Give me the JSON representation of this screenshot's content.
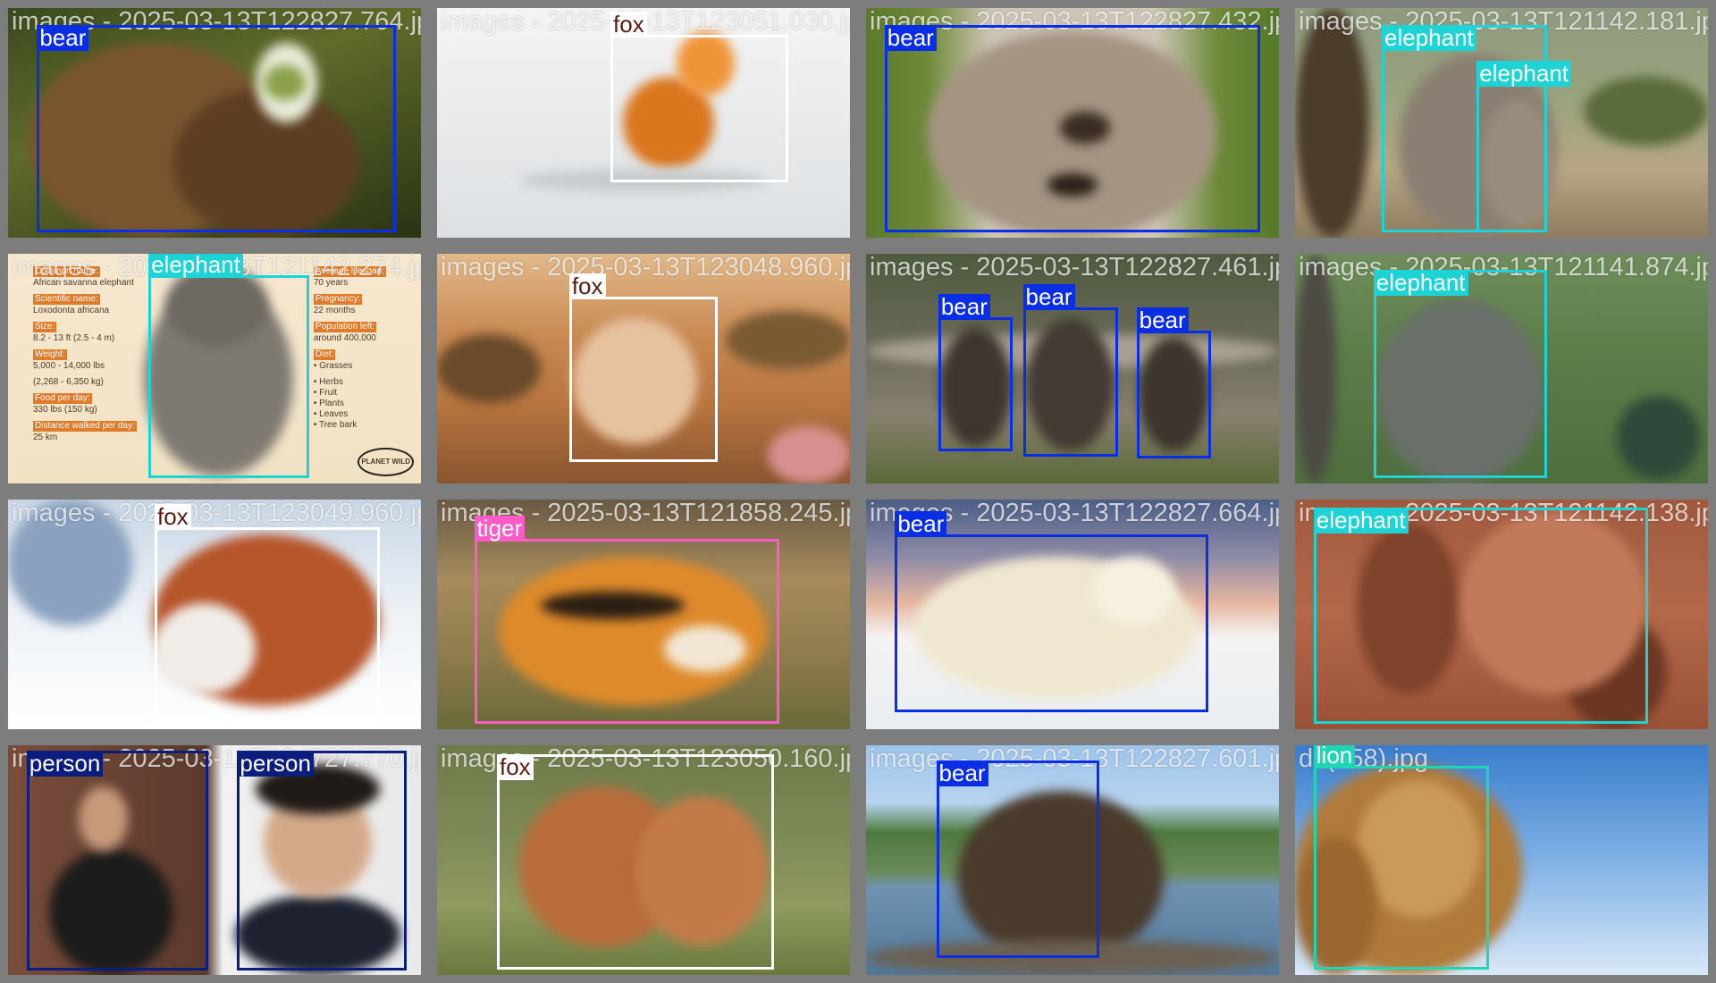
{
  "colors": {
    "bear": "#0a2ee6",
    "fox": "#ffffff",
    "elephant": "#1dd3d6",
    "tiger": "#ff5bc8",
    "person": "#0b1e7d",
    "lion": "#1fd6b4"
  },
  "tiles": [
    {
      "filename": "images - 2025-03-13T122827.764.jpg",
      "scene": "bear-green",
      "detections": [
        {
          "label": "bear",
          "cls": "bear"
        }
      ]
    },
    {
      "filename": "images - 2025-03-13T123051.030.jpg",
      "scene": "fox-snow",
      "detections": [
        {
          "label": "fox",
          "cls": "fox"
        }
      ]
    },
    {
      "filename": "images - 2025-03-13T122827.432.jpg",
      "scene": "bear-closeup",
      "detections": [
        {
          "label": "bear",
          "cls": "bear"
        }
      ]
    },
    {
      "filename": "images - 2025-03-13T121142.181.jpg",
      "scene": "elephants-trees",
      "detections": [
        {
          "label": "elephant",
          "cls": "elephant"
        },
        {
          "label": "elephant",
          "cls": "elephant"
        }
      ]
    },
    {
      "filename": "images - 2025-03-13T121142.274.jpg",
      "scene": "infographic",
      "detections": [
        {
          "label": "elephant",
          "cls": "elephant"
        }
      ],
      "infographic": {
        "left": [
          {
            "head": "Common name:",
            "text": "African savanna elephant"
          },
          {
            "head": "Scientific name:",
            "text": "Loxodonta africana"
          },
          {
            "head": "Size:",
            "text": "8.2 - 13 ft (2.5 - 4 m)"
          },
          {
            "head": "Weight:",
            "text": "5,000 - 14,000 lbs"
          },
          {
            "head": "",
            "text": "(2,268 - 6,350 kg)"
          },
          {
            "head": "Food per day:",
            "text": "330 lbs (150 kg)"
          },
          {
            "head": "Distance walked per day:",
            "text": "25 km"
          }
        ],
        "right": [
          {
            "head": "Average lifespan:",
            "text": "70 years"
          },
          {
            "head": "Pregnancy:",
            "text": "22 months"
          },
          {
            "head": "Population left:",
            "text": "around 400,000"
          },
          {
            "head": "Diet:",
            "text": "• Grasses"
          },
          {
            "head": "",
            "text": "• Herbs"
          },
          {
            "head": "",
            "text": "• Fruit"
          },
          {
            "head": "",
            "text": "• Plants"
          },
          {
            "head": "",
            "text": "• Leaves"
          },
          {
            "head": "",
            "text": "• Tree bark"
          }
        ],
        "logo": "PLANET WILD"
      }
    },
    {
      "filename": "images - 2025-03-13T123048.960.jpg",
      "scene": "fox-desert",
      "detections": [
        {
          "label": "fox",
          "cls": "fox"
        }
      ]
    },
    {
      "filename": "images - 2025-03-13T122827.461.jpg",
      "scene": "bear-cubs",
      "detections": [
        {
          "label": "bear",
          "cls": "bear"
        },
        {
          "label": "bear",
          "cls": "bear"
        },
        {
          "label": "bear",
          "cls": "bear"
        }
      ]
    },
    {
      "filename": "images - 2025-03-13T121141.874.jpg",
      "scene": "elephant-forest",
      "detections": [
        {
          "label": "elephant",
          "cls": "elephant"
        }
      ]
    },
    {
      "filename": "images - 2025-03-13T123049.960.jpg",
      "scene": "fox-winter",
      "detections": [
        {
          "label": "fox",
          "cls": "fox"
        }
      ]
    },
    {
      "filename": "images - 2025-03-13T121858.245.jpg",
      "scene": "tiger",
      "detections": [
        {
          "label": "tiger",
          "cls": "tiger"
        }
      ]
    },
    {
      "filename": "images - 2025-03-13T122827.664.jpg",
      "scene": "polar-bear",
      "detections": [
        {
          "label": "bear",
          "cls": "bear"
        }
      ]
    },
    {
      "filename": "images - 2025-03-13T121142.138.jpg",
      "scene": "elephant-closeup",
      "detections": [
        {
          "label": "elephant",
          "cls": "elephant"
        }
      ]
    },
    {
      "filename": "images - 2025-03-13T134727.770.jpg",
      "scene": "people",
      "detections": [
        {
          "label": "person",
          "cls": "person"
        },
        {
          "label": "person",
          "cls": "person"
        }
      ]
    },
    {
      "filename": "images - 2025-03-13T123050.160.jpg",
      "scene": "fox-kits",
      "detections": [
        {
          "label": "fox",
          "cls": "fox"
        }
      ]
    },
    {
      "filename": "images - 2025-03-13T122827.601.jpg",
      "scene": "bear-river",
      "detections": [
        {
          "label": "bear",
          "cls": "bear"
        }
      ]
    },
    {
      "filename": "dl (258).jpg",
      "scene": "lion",
      "detections": [
        {
          "label": "lion",
          "cls": "lion"
        }
      ]
    }
  ]
}
